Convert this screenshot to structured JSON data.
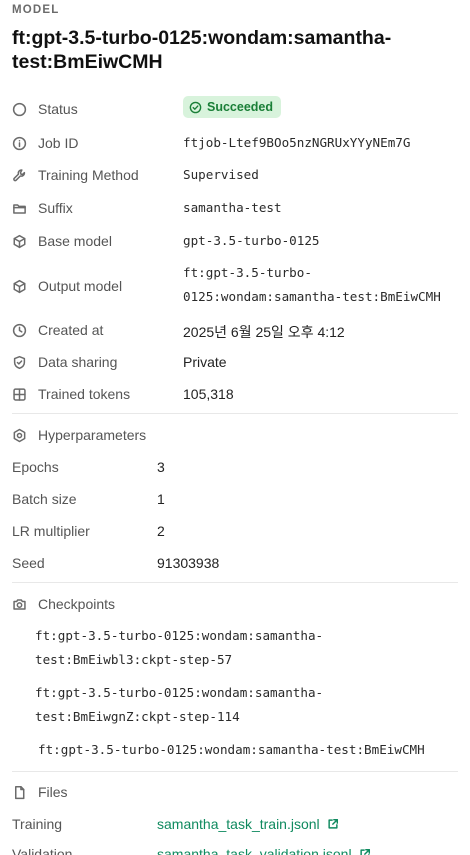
{
  "header": {
    "eyebrow": "MODEL",
    "title": "ft:gpt-3.5-turbo-0125:wondam:samantha-test:BmEiwCMH"
  },
  "details": {
    "status": {
      "label": "Status",
      "value": "Succeeded"
    },
    "job_id": {
      "label": "Job ID",
      "value": "ftjob-Ltef9BOo5nzNGRUxYYyNEm7G"
    },
    "training_method": {
      "label": "Training Method",
      "value": "Supervised"
    },
    "suffix": {
      "label": "Suffix",
      "value": "samantha-test"
    },
    "base_model": {
      "label": "Base model",
      "value": "gpt-3.5-turbo-0125"
    },
    "output_model": {
      "label": "Output model",
      "value_line1": "ft:gpt-3.5-turbo-",
      "value_line2": "0125:wondam:samantha-test:BmEiwCMH"
    },
    "created_at": {
      "label": "Created at",
      "value": "2025년 6월 25일 오후 4:12"
    },
    "data_sharing": {
      "label": "Data sharing",
      "value": "Private"
    },
    "trained_tokens": {
      "label": "Trained tokens",
      "value": "105,318"
    }
  },
  "hyperparameters": {
    "heading": "Hyperparameters",
    "epochs": {
      "label": "Epochs",
      "value": "3"
    },
    "batch_size": {
      "label": "Batch size",
      "value": "1"
    },
    "lr_multiplier": {
      "label": "LR multiplier",
      "value": "2"
    },
    "seed": {
      "label": "Seed",
      "value": "91303938"
    }
  },
  "checkpoints": {
    "heading": "Checkpoints",
    "items": [
      {
        "line1": "ft:gpt-3.5-turbo-0125:wondam:samantha-",
        "line2": "test:BmEiwbl3:ckpt-step-57"
      },
      {
        "line1": "ft:gpt-3.5-turbo-0125:wondam:samantha-",
        "line2": "test:BmEiwgnZ:ckpt-step-114"
      },
      {
        "line1": "ft:gpt-3.5-turbo-0125:wondam:samantha-test:BmEiwCMH"
      }
    ]
  },
  "files": {
    "heading": "Files",
    "training": {
      "label": "Training",
      "value": "samantha_task_train.jsonl"
    },
    "validation": {
      "label": "Validation",
      "value": "samantha_task_validation.jsonl"
    }
  },
  "colors": {
    "success_bg": "#d8f3dc",
    "success_text": "#1a7f37",
    "link": "#0f8a5f"
  },
  "icons": {
    "status": "circle-icon",
    "job_id": "info-icon",
    "training_method": "wrench-icon",
    "suffix": "folder-icon",
    "base_model": "cube-icon",
    "output_model": "cube-icon",
    "created_at": "clock-icon",
    "data_sharing": "shield-icon",
    "trained_tokens": "grid-icon",
    "hyperparameters": "gear-icon",
    "checkpoints": "camera-icon",
    "files": "file-icon"
  }
}
